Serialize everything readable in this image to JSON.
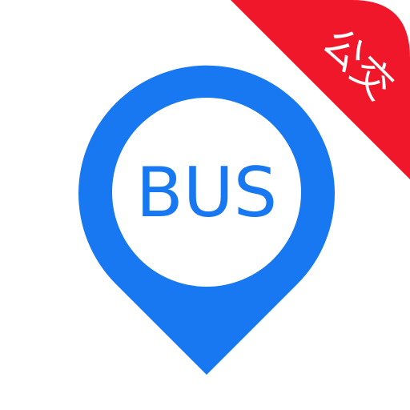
{
  "icon": {
    "label": "BUS",
    "badge_label": "公交",
    "pin_icon": "map-pin-icon",
    "colors": {
      "pin_blue": "#1778F2",
      "inner_circle": "#FFFFFF",
      "badge_red": "#F0172A",
      "badge_text": "#FFFFFF",
      "background": "#FFFFFF"
    }
  }
}
